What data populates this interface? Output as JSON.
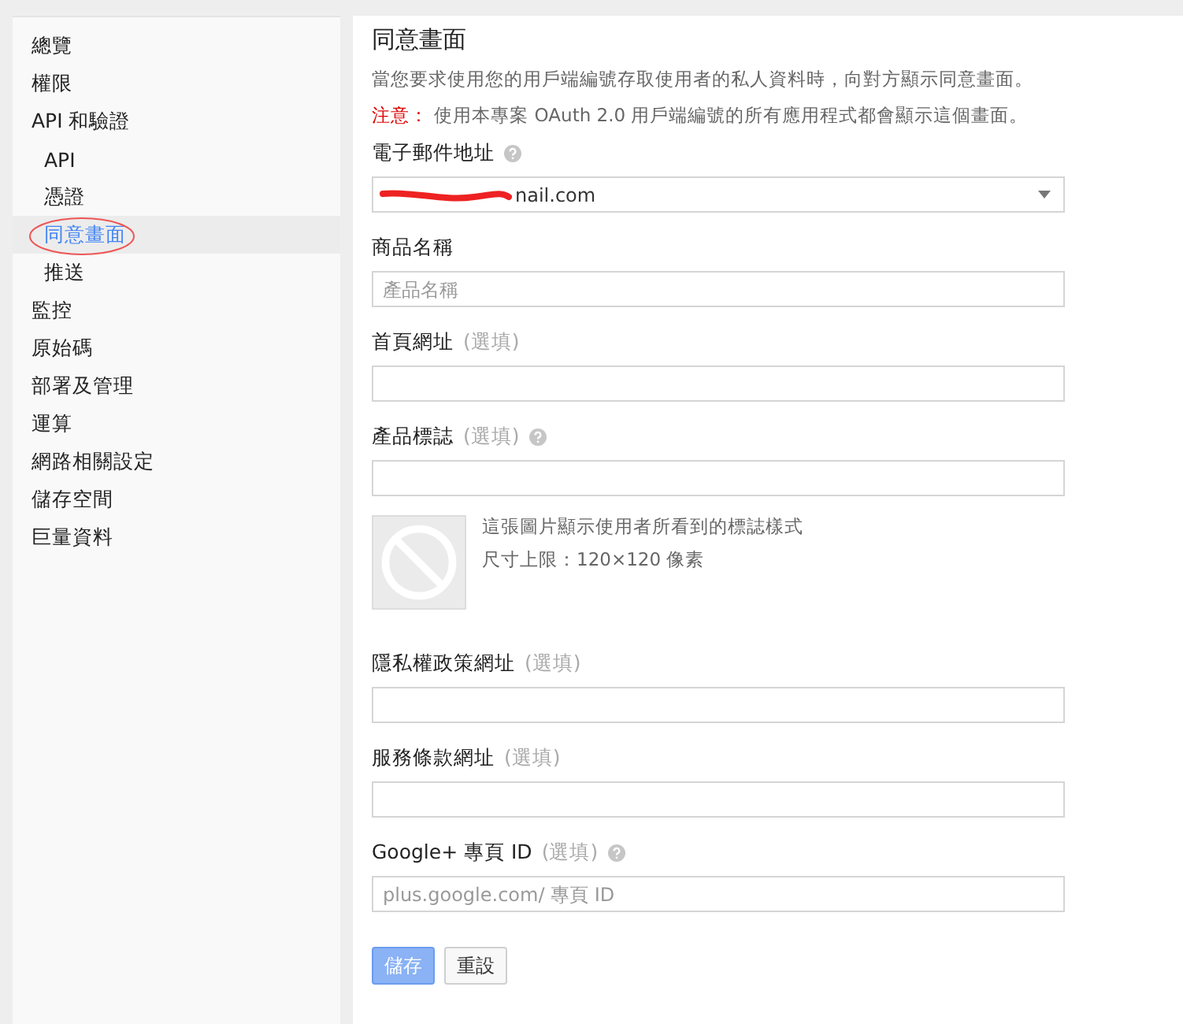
{
  "sidebar": {
    "items": [
      {
        "label": "總覽",
        "selected": false
      },
      {
        "label": "權限",
        "selected": false
      },
      {
        "label": "API 和驗證",
        "selected": false,
        "children": [
          {
            "label": "API",
            "selected": false
          },
          {
            "label": "憑證",
            "selected": false
          },
          {
            "label": "同意畫面",
            "selected": true,
            "annotated": true
          },
          {
            "label": "推送",
            "selected": false
          }
        ]
      },
      {
        "label": "監控",
        "selected": false
      },
      {
        "label": "原始碼",
        "selected": false
      },
      {
        "label": "部署及管理",
        "selected": false
      },
      {
        "label": "運算",
        "selected": false
      },
      {
        "label": "網路相關設定",
        "selected": false
      },
      {
        "label": "儲存空間",
        "selected": false
      },
      {
        "label": "巨量資料",
        "selected": false
      }
    ]
  },
  "page": {
    "title": "同意畫面",
    "description": "當您要求使用您的用戶端編號存取使用者的私人資料時，向對方顯示同意畫面。",
    "notice_label": "注意：",
    "notice": "使用本專案 OAuth 2.0 用戶端編號的所有應用程式都會顯示這個畫面。"
  },
  "fields": [
    {
      "kind": "select",
      "label": "電子郵件地址",
      "help": true,
      "value": "nail.com",
      "redacted": true
    },
    {
      "kind": "text",
      "label": "商品名稱",
      "help": false,
      "placeholder": "產品名稱"
    },
    {
      "kind": "text",
      "label": "首頁網址",
      "optional": "(選填)",
      "help": false
    },
    {
      "kind": "text",
      "label": "產品標誌",
      "optional": "(選填)",
      "help": true,
      "logo_preview": {
        "caption": "這張圖片顯示使用者所看到的標誌樣式",
        "size_label": "尺寸上限：",
        "size": "120×120 像素"
      }
    },
    {
      "kind": "text",
      "label": "隱私權政策網址",
      "optional": "(選填)",
      "help": false
    },
    {
      "kind": "text",
      "label": "服務條款網址",
      "optional": "(選填)",
      "help": false
    },
    {
      "kind": "text",
      "label": "Google+ 專頁 ID",
      "optional": "(選填)",
      "help": true,
      "placeholder": "plus.google.com/ 專頁 ID"
    }
  ],
  "buttons": [
    {
      "kind": "primary",
      "label": "儲存",
      "disabled": true
    },
    {
      "kind": "secondary",
      "label": "重設",
      "disabled": false
    }
  ]
}
